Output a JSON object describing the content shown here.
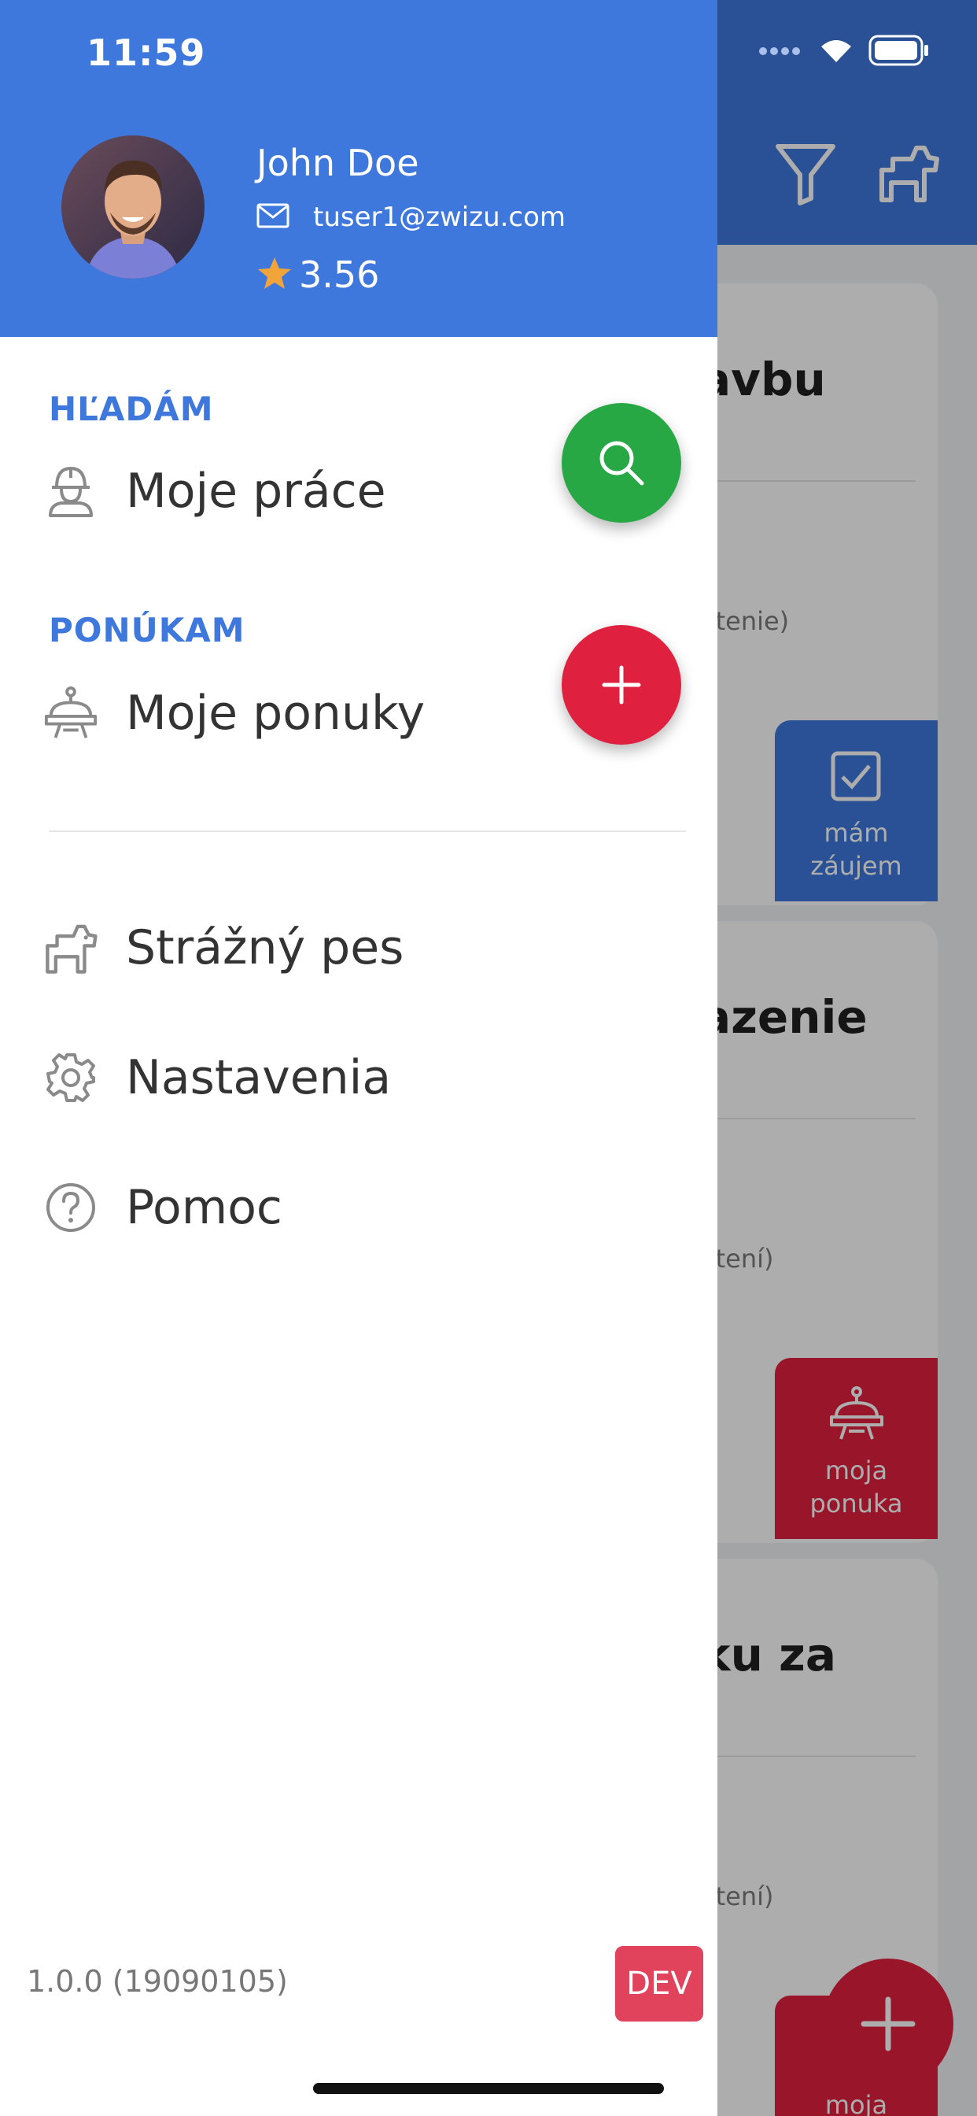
{
  "status_bar": {
    "time": "11:59"
  },
  "user": {
    "name": "John Doe",
    "email": "tuser1@zwizu.com",
    "rating": "3.56"
  },
  "sections": {
    "seeking": {
      "label": "HĽADÁM",
      "item": "Moje práce"
    },
    "offering": {
      "label": "PONÚKAM",
      "item": "Moje ponuky"
    }
  },
  "menu": [
    {
      "label": "Strážný pes",
      "icon": "dog-icon"
    },
    {
      "label": "Nastavenia",
      "icon": "gear-icon"
    },
    {
      "label": "Pomoc",
      "icon": "help-icon"
    }
  ],
  "footer": {
    "version": "1.0.0 (19090105)",
    "env_badge": "DEV"
  },
  "background_app": {
    "cards": [
      {
        "title": "avbu",
        "meta": "otenie)"
      },
      {
        "title": "azenie",
        "meta": "otení)"
      },
      {
        "title": "ku za",
        "meta": "otení)"
      }
    ],
    "badges": [
      {
        "label_line1": "mám",
        "label_line2": "záujem",
        "color": "#3e78dc"
      },
      {
        "label_line1": "moja",
        "label_line2": "ponuka",
        "color": "#e0203f"
      },
      {
        "label_line1": "moja",
        "color": "#e0203f"
      }
    ]
  },
  "colors": {
    "primary": "#3e78dc",
    "search_fab": "#28a745",
    "add_fab": "#e0203f",
    "rating_star": "#f0a43a",
    "dev_badge": "#e0435b"
  }
}
